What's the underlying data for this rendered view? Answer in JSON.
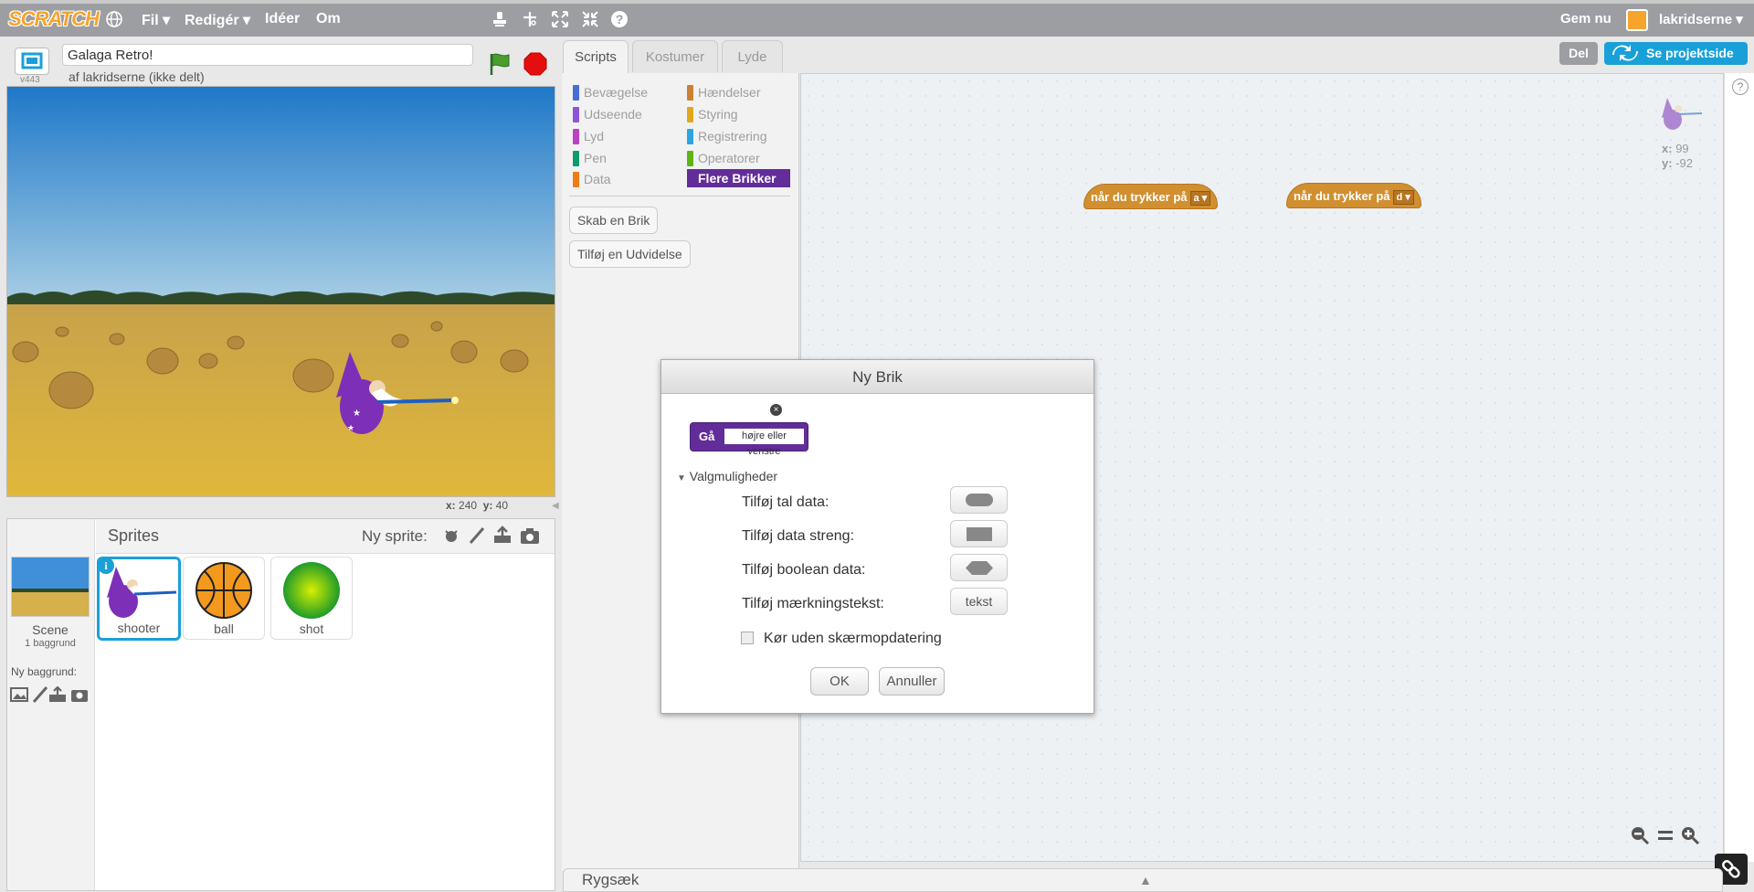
{
  "topbar": {
    "logo": "SCRATCH",
    "menus": [
      "Fil ▾",
      "Redigér ▾",
      "Idéer",
      "Om"
    ],
    "save_now": "Gem nu",
    "username": "lakridserne ▾"
  },
  "project": {
    "title": "Galaga Retro!",
    "author": "af lakridserne (ikke delt)",
    "version": "v443",
    "share_button": "Del",
    "see_project_page": "Se projektside"
  },
  "stage": {
    "coords": {
      "x_label": "x:",
      "x": "240",
      "y_label": "y:",
      "y": "40"
    }
  },
  "sprites_panel": {
    "header": "Sprites",
    "new_sprite": "Ny sprite:",
    "scene_label": "Scene",
    "backdrop_count": "1 baggrund",
    "new_backdrop": "Ny baggrund:",
    "sprites": [
      {
        "name": "shooter",
        "selected": true
      },
      {
        "name": "ball",
        "selected": false
      },
      {
        "name": "shot",
        "selected": false
      }
    ]
  },
  "tabs": [
    "Scripts",
    "Kostumer",
    "Lyde"
  ],
  "palette": {
    "categories_left": [
      {
        "label": "Bevægelse",
        "color": "#4a6cd4"
      },
      {
        "label": "Udseende",
        "color": "#8a55d7"
      },
      {
        "label": "Lyd",
        "color": "#bb42c3"
      },
      {
        "label": "Pen",
        "color": "#0e9a6c"
      },
      {
        "label": "Data",
        "color": "#ee7d16"
      }
    ],
    "categories_right": [
      {
        "label": "Hændelser",
        "color": "#c88330"
      },
      {
        "label": "Styring",
        "color": "#e1a91a"
      },
      {
        "label": "Registrering",
        "color": "#2ca5e2"
      },
      {
        "label": "Operatorer",
        "color": "#5cb712"
      },
      {
        "label": "Flere Brikker",
        "color": "#632d99"
      }
    ],
    "make_block": "Skab en Brik",
    "add_extension": "Tilføj en Udvidelse"
  },
  "scripts_area": {
    "sprite_x_label": "x:",
    "sprite_x": "99",
    "sprite_y_label": "y:",
    "sprite_y": "-92",
    "hat_blocks": [
      {
        "text": "når du trykker på",
        "key": "a"
      },
      {
        "text": "når du trykker på",
        "key": "d"
      }
    ]
  },
  "backpack": "Rygsæk",
  "dialog": {
    "title": "Ny Brik",
    "block_label": "Gå",
    "block_input": "højre eller venstre",
    "options_toggle": "Valgmuligheder",
    "add_number": "Tilføj tal data:",
    "add_string": "Tilføj data streng:",
    "add_boolean": "Tilføj boolean data:",
    "add_label": "Tilføj mærkningstekst:",
    "label_button": "tekst",
    "run_without_refresh": "Kør uden skærmopdatering",
    "ok": "OK",
    "cancel": "Annuller"
  },
  "colors": {
    "topbar": "#9c9ea2",
    "accent_blue": "#1aa0d8",
    "more_blocks": "#632d99",
    "events": "#d18f30"
  }
}
